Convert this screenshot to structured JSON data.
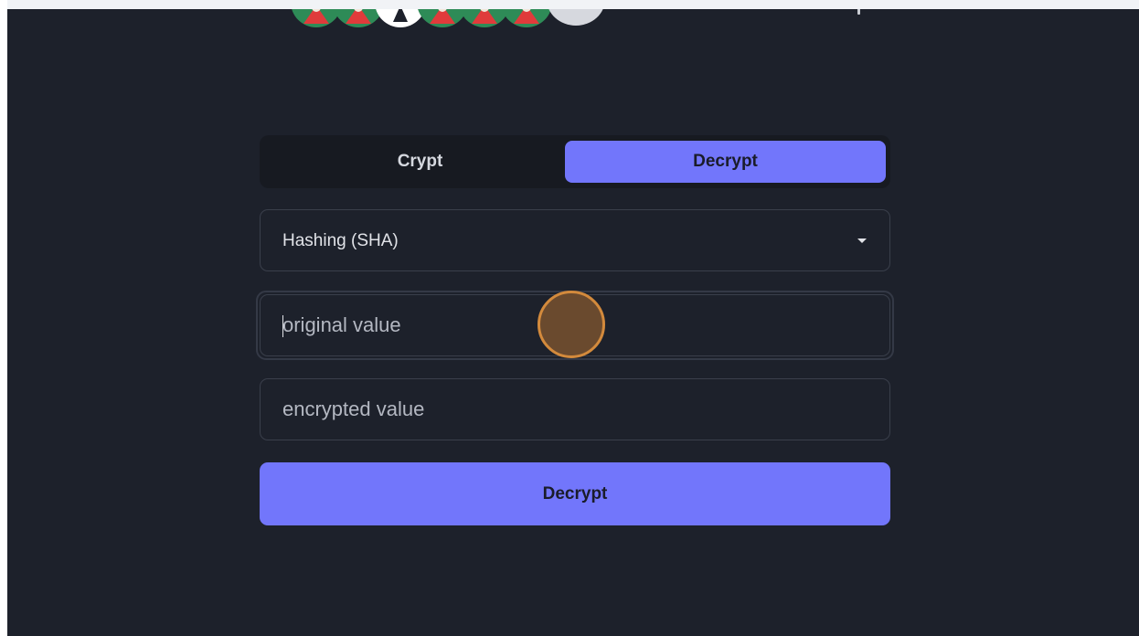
{
  "tabs": {
    "crypt_label": "Crypt",
    "decrypt_label": "Decrypt",
    "active": "Decrypt"
  },
  "algorithm_select": {
    "selected": "Hashing (SHA)",
    "icon": "chevron-down-icon"
  },
  "original_input": {
    "placeholder": "original value",
    "value": ""
  },
  "encrypted_input": {
    "placeholder": "encrypted value",
    "value": ""
  },
  "action_button": {
    "label": "Decrypt"
  },
  "colors": {
    "background": "#1d212b",
    "accent": "#7276fb",
    "border": "#3a3f4b",
    "click_indicator": "#d38a3c"
  }
}
